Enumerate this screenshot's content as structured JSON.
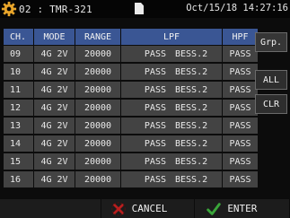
{
  "status": {
    "device": "02 : TMR-321",
    "datetime": "Oct/15/18 14:27:16",
    "icons": [
      "gear-icon",
      "sd-card-icon"
    ]
  },
  "table": {
    "headers": [
      "CH.",
      "MODE",
      "RANGE",
      "LPF",
      "HPF"
    ],
    "rows": [
      {
        "ch": "09",
        "mode": "4G 2V",
        "range": "20000",
        "lpf_pass": "PASS",
        "lpf_filter": "BESS.2",
        "hpf": "PASS"
      },
      {
        "ch": "10",
        "mode": "4G 2V",
        "range": "20000",
        "lpf_pass": "PASS",
        "lpf_filter": "BESS.2",
        "hpf": "PASS"
      },
      {
        "ch": "11",
        "mode": "4G 2V",
        "range": "20000",
        "lpf_pass": "PASS",
        "lpf_filter": "BESS.2",
        "hpf": "PASS"
      },
      {
        "ch": "12",
        "mode": "4G 2V",
        "range": "20000",
        "lpf_pass": "PASS",
        "lpf_filter": "BESS.2",
        "hpf": "PASS"
      },
      {
        "ch": "13",
        "mode": "4G 2V",
        "range": "20000",
        "lpf_pass": "PASS",
        "lpf_filter": "BESS.2",
        "hpf": "PASS"
      },
      {
        "ch": "14",
        "mode": "4G 2V",
        "range": "20000",
        "lpf_pass": "PASS",
        "lpf_filter": "BESS.2",
        "hpf": "PASS"
      },
      {
        "ch": "15",
        "mode": "4G 2V",
        "range": "20000",
        "lpf_pass": "PASS",
        "lpf_filter": "BESS.2",
        "hpf": "PASS"
      },
      {
        "ch": "16",
        "mode": "4G 2V",
        "range": "20000",
        "lpf_pass": "PASS",
        "lpf_filter": "BESS.2",
        "hpf": "PASS"
      }
    ]
  },
  "side_buttons": {
    "grp": "Grp.",
    "all": "ALL",
    "clr": "CLR"
  },
  "bottom": {
    "cancel": "CANCEL",
    "enter": "ENTER",
    "cancel_icon": "cancel-x-icon",
    "enter_icon": "checkmark-icon"
  },
  "colors": {
    "header_bg": "#3a5694",
    "row_bg": "#434343",
    "gear": "#e8a52a",
    "cancel_icon": "#b81e1e",
    "enter_icon": "#3aa63a"
  }
}
